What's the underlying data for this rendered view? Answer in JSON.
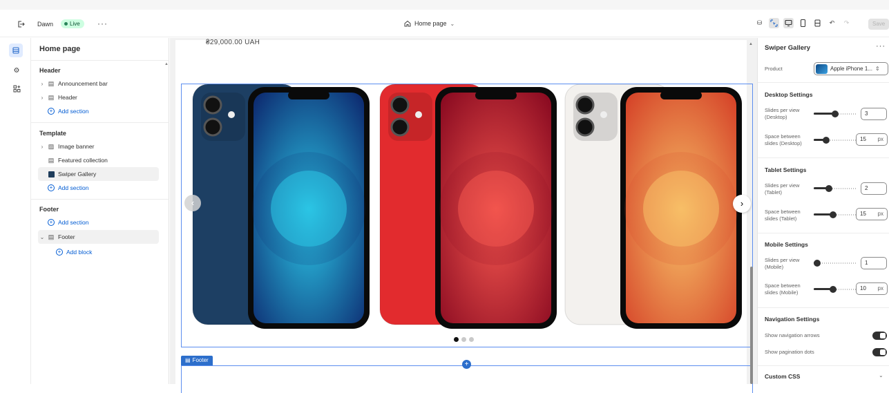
{
  "topbar": {
    "theme_name": "Dawn",
    "status_badge": "Live",
    "page_selector": "Home page",
    "save_label": "Save"
  },
  "left_panel": {
    "title": "Home page",
    "header_group": "Header",
    "header_items": [
      "Announcement bar",
      "Header"
    ],
    "template_group": "Template",
    "template_items": [
      "Image banner",
      "Featured collection",
      "Swiper Gallery"
    ],
    "footer_group": "Footer",
    "footer_items": [
      "Footer"
    ],
    "add_section": "Add section",
    "add_block": "Add block"
  },
  "preview": {
    "price_text": "₴29,000.00 UAH",
    "footer_tag": "Footer",
    "pagination": {
      "total": 3,
      "active": 1
    },
    "slides": [
      {
        "color": "blue",
        "back": "#1d3f63",
        "screen_a": "#2bc6e6",
        "screen_b": "#0e2e73"
      },
      {
        "color": "red",
        "back": "#e22b2e",
        "screen_a": "#f3564e",
        "screen_b": "#8c0c22"
      },
      {
        "color": "white",
        "back": "#f3f1ee",
        "screen_a": "#f7c067",
        "screen_b": "#d6462a"
      }
    ]
  },
  "right_panel": {
    "title": "Swiper Gallery",
    "product_label": "Product",
    "product_value": "Apple iPhone 1...",
    "desktop": {
      "heading": "Desktop Settings",
      "slides_label_1": "Slides per view",
      "slides_label_2": "(Desktop)",
      "slides_value": "3",
      "slides_level": 0.5,
      "space_label_1": "Space between",
      "space_label_2": "slides (Desktop)",
      "space_value": "15",
      "space_level": 0.25,
      "unit": "px"
    },
    "tablet": {
      "heading": "Tablet Settings",
      "slides_label_1": "Slides per view",
      "slides_label_2": "(Tablet)",
      "slides_value": "2",
      "slides_level": 0.33,
      "space_label_1": "Space between",
      "space_label_2": "slides (Tablet)",
      "space_value": "15",
      "space_level": 0.45,
      "unit": "px"
    },
    "mobile": {
      "heading": "Mobile Settings",
      "slides_label_1": "Slides per view",
      "slides_label_2": "(Mobile)",
      "slides_value": "1",
      "slides_level": 0.0,
      "space_label_1": "Space between",
      "space_label_2": "slides (Mobile)",
      "space_value": "10",
      "space_level": 0.45,
      "unit": "px"
    },
    "navigation": {
      "heading": "Navigation Settings",
      "arrows_label": "Show navigation arrows",
      "dots_label": "Show pagination dots"
    },
    "custom_css": "Custom CSS"
  }
}
